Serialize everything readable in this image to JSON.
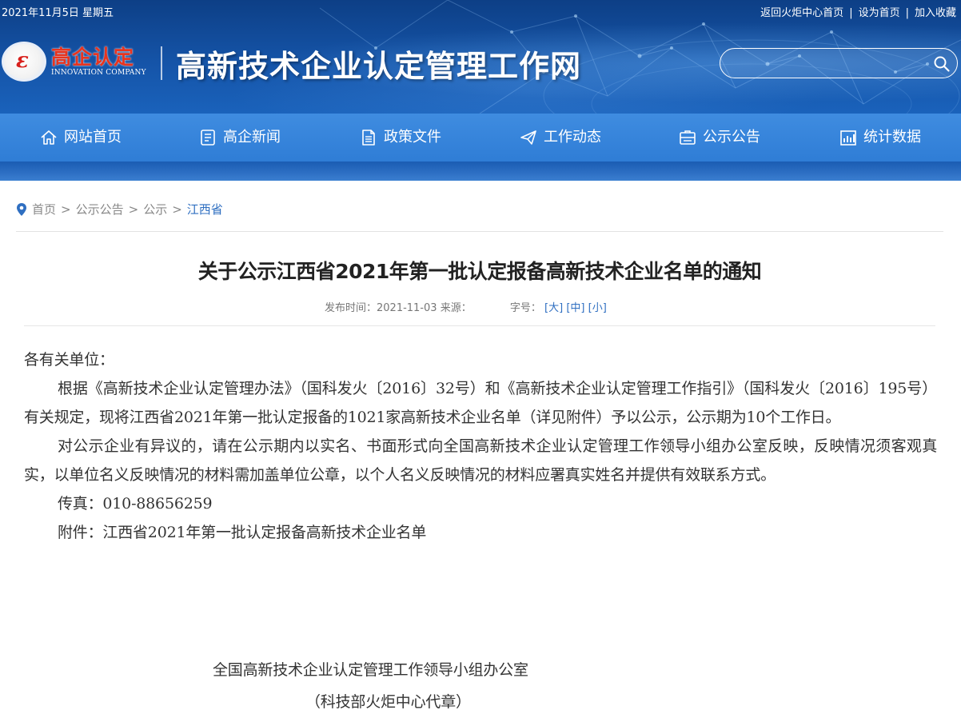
{
  "topbar": {
    "date": "2021年11月5日 星期五",
    "links": [
      "返回火炬中心首页",
      "设为首页",
      "加入收藏"
    ],
    "separator": "|"
  },
  "header": {
    "logo_mark": "ε",
    "logo_cn": "高企认定",
    "logo_en": "INNOVATION COMPANY",
    "site_title": "高新技术企业认定管理工作网",
    "search_placeholder": "",
    "search_icon": "search-icon"
  },
  "nav": {
    "items": [
      {
        "label": "网站首页",
        "icon": "home-icon"
      },
      {
        "label": "高企新闻",
        "icon": "news-icon"
      },
      {
        "label": "政策文件",
        "icon": "document-icon"
      },
      {
        "label": "工作动态",
        "icon": "paper-plane-icon"
      },
      {
        "label": "公示公告",
        "icon": "notice-icon"
      },
      {
        "label": "统计数据",
        "icon": "chart-icon"
      }
    ]
  },
  "breadcrumb": {
    "icon": "location-pin-icon",
    "items": [
      "首页",
      "公示公告",
      "公示",
      "江西省"
    ],
    "separator": ">"
  },
  "article": {
    "title": "关于公示江西省2021年第一批认定报备高新技术企业名单的通知",
    "publish_label": "发布时间：",
    "publish_date": "2021-11-03",
    "source_label": "来源：",
    "source_value": "",
    "font_size_label": "字号：",
    "font_sizes": [
      "[大]",
      "[中]",
      "[小]"
    ],
    "salutation": "各有关单位：",
    "paragraph1": "根据《高新技术企业认定管理办法》（国科发火〔2016〕32号）和《高新技术企业认定管理工作指引》（国科发火〔2016〕195号）有关规定，现将江西省2021年第一批认定报备的1021家高新技术企业名单（详见附件）予以公示，公示期为10个工作日。",
    "paragraph2": "对公示企业有异议的，请在公示期内以实名、书面形式向全国高新技术企业认定管理工作领导小组办公室反映，反映情况须客观真实，以单位名义反映情况的材料需加盖单位公章，以个人名义反映情况的材料应署真实姓名并提供有效联系方式。",
    "fax": "传真：010-88656259",
    "attachment_label": "附件：",
    "attachment_link": "江西省2021年第一批认定报备高新技术企业名单",
    "signature_org": "全国高新技术企业认定管理工作领导小组办公室",
    "signature_note": "（科技部火炬中心代章）"
  },
  "colors": {
    "header_bg": "#1554a8",
    "nav_bg": "#3a87dd",
    "accent_link": "#2f6fc1",
    "logo_red": "#e8341f"
  }
}
